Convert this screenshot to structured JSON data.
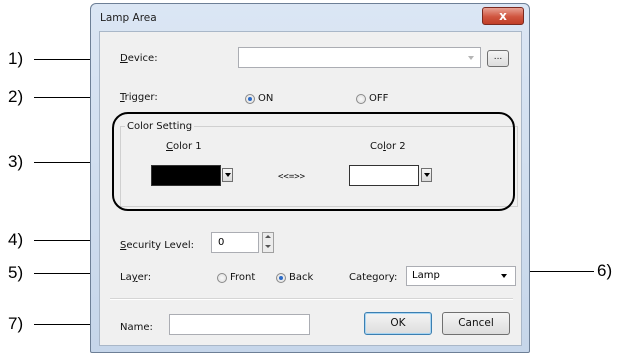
{
  "callouts": [
    "1)",
    "2)",
    "3)",
    "4)",
    "5)",
    "6)",
    "7)"
  ],
  "dialog": {
    "title": "Lamp Area",
    "close_glyph": "x",
    "device": {
      "mnemonic": "D",
      "rest": "evice:",
      "value": "",
      "browse_label": "..."
    },
    "trigger": {
      "mnemonic": "T",
      "rest": "rigger:",
      "on_label": "ON",
      "off_label": "OFF",
      "selected": "ON"
    },
    "color_setting": {
      "title": "Color Setting",
      "color1": {
        "mnemonic": "C",
        "rest": "olor 1",
        "value": "#000000"
      },
      "swap": "<<=>>",
      "color2": {
        "pre": "Co",
        "mnemonic": "l",
        "rest": "or 2",
        "value": "#ffffff"
      }
    },
    "security": {
      "mnemonic": "S",
      "rest": "ecurity Level:",
      "value": "0"
    },
    "layer": {
      "pre": "La",
      "mnemonic": "y",
      "rest": "er:",
      "front_label": "Front",
      "back_label": "Back",
      "selected": "Back"
    },
    "category": {
      "label": "Category:",
      "value": "Lamp"
    },
    "name": {
      "label": "Name:",
      "value": ""
    },
    "ok_label": "OK",
    "cancel_label": "Cancel"
  },
  "colors": {
    "selection": "#2c6bc7",
    "border": "#6d7f96"
  },
  "icons": [
    "close-icon",
    "dropdown-arrow-icon",
    "spin-up-icon",
    "spin-down-icon"
  ]
}
